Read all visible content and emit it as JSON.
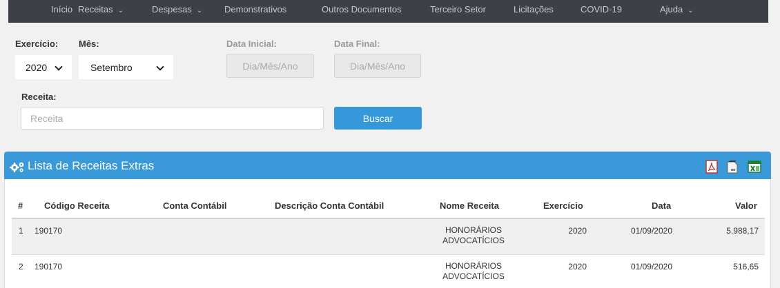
{
  "nav": {
    "items": [
      {
        "label": "Início",
        "caret": false
      },
      {
        "label": "Receitas",
        "caret": true
      },
      {
        "label": "Despesas",
        "caret": true
      },
      {
        "label": "Demonstrativos",
        "caret": false
      },
      {
        "label": "Outros Documentos",
        "caret": false
      },
      {
        "label": "Terceiro Setor",
        "caret": false
      },
      {
        "label": "Licitações",
        "caret": false
      },
      {
        "label": "COVID-19",
        "caret": false
      },
      {
        "label": "Ajuda",
        "caret": true
      }
    ]
  },
  "filters": {
    "exercicio_label": "Exercício:",
    "exercicio_value": "2020",
    "mes_label": "Mês:",
    "mes_value": "Setembro",
    "data_inicial_label": "Data Inicial:",
    "data_inicial_placeholder": "Dia/Mês/Ano",
    "data_final_label": "Data Final:",
    "data_final_placeholder": "Dia/Mês/Ano",
    "receita_label": "Receita:",
    "receita_placeholder": "Receita",
    "buscar_label": "Buscar"
  },
  "panel": {
    "title": "Lista de Receitas Extras",
    "export_icons": [
      "pdf-icon",
      "txt-icon",
      "excel-icon"
    ]
  },
  "table": {
    "headers": [
      "#",
      "Código Receita",
      "Conta Contábil",
      "Descrição Conta Contábil",
      "Nome Receita",
      "Exercício",
      "Data",
      "Valor"
    ],
    "rows": [
      {
        "n": "1",
        "codigo": "190170",
        "conta": "",
        "descricao": "",
        "nome_l1": "HONORÁRIOS",
        "nome_l2": "ADVOCATÍCIOS",
        "exercicio": "2020",
        "data": "01/09/2020",
        "valor": "5.988,17"
      },
      {
        "n": "2",
        "codigo": "190170",
        "conta": "",
        "descricao": "",
        "nome_l1": "HONORÁRIOS",
        "nome_l2": "ADVOCATÍCIOS",
        "exercicio": "2020",
        "data": "01/09/2020",
        "valor": "516,65"
      }
    ]
  },
  "colors": {
    "nav_bg": "#3d4147",
    "accent": "#3498db",
    "panel_head": "#3a9ad9"
  }
}
